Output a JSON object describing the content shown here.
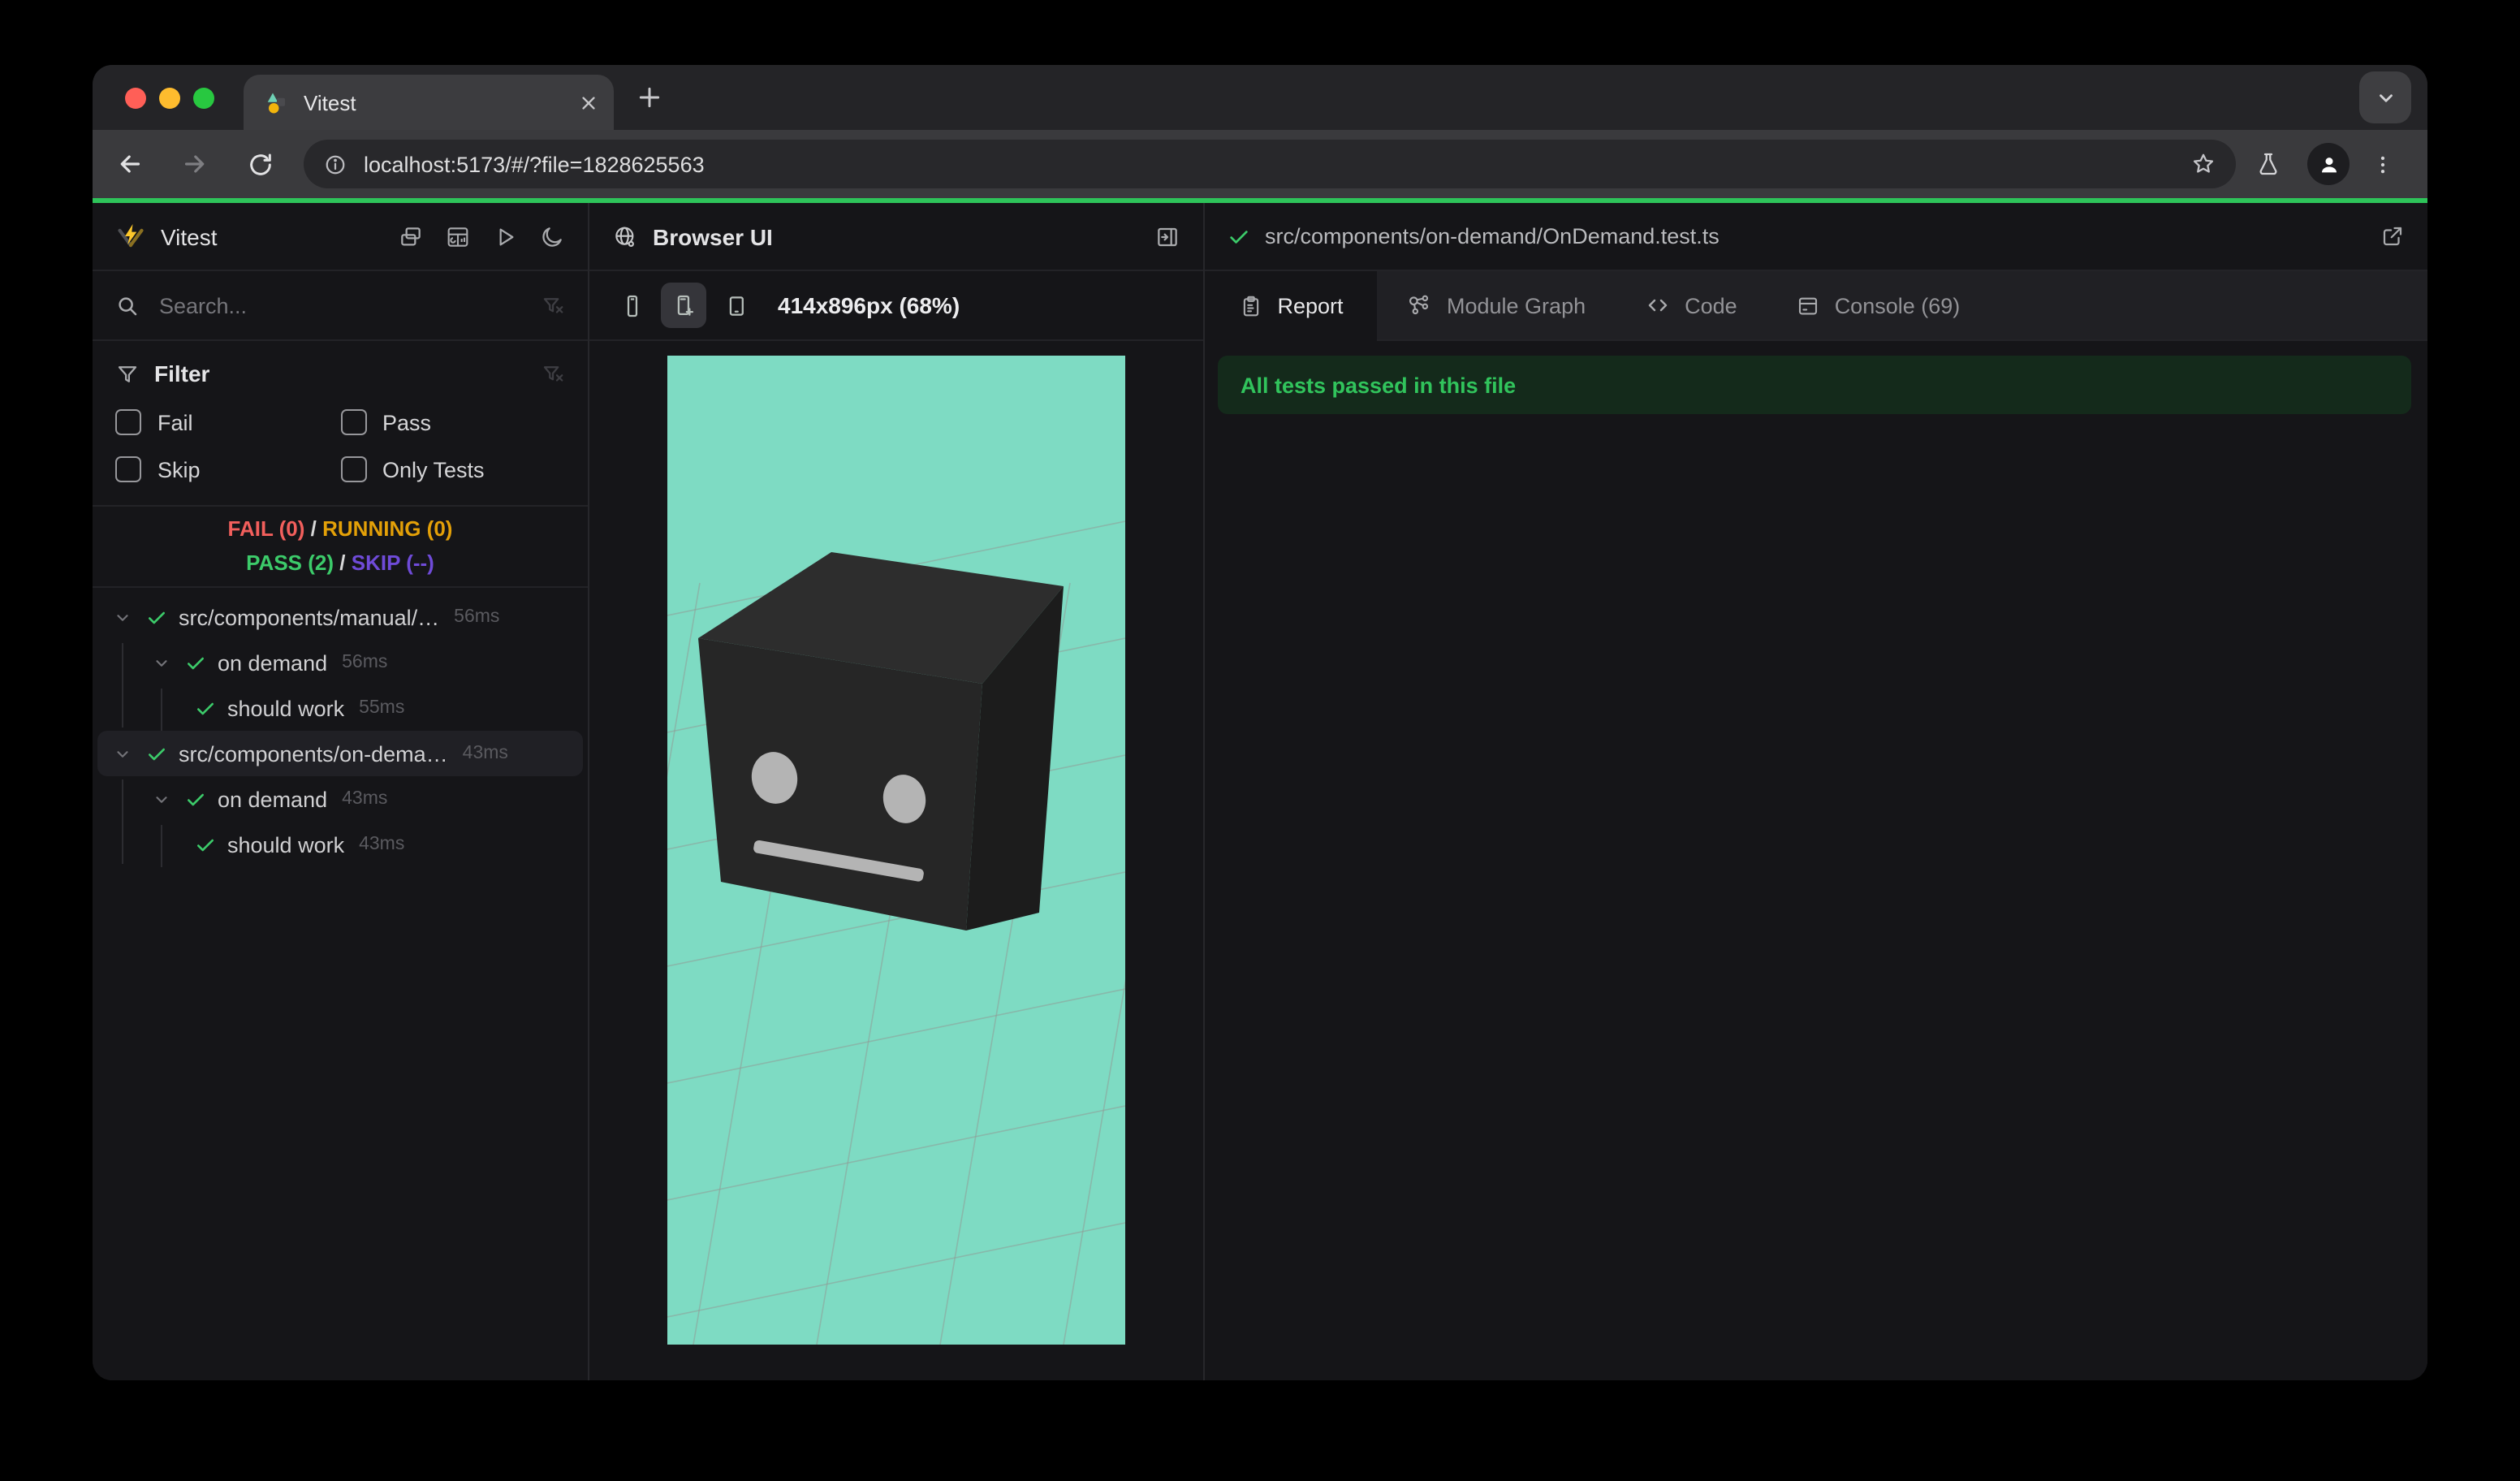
{
  "colors": {
    "accent_green": "#2ec45a",
    "pass_green": "#3ccb6a",
    "fail_red": "#f25f5c",
    "running_yellow": "#e3a008",
    "skip_purple": "#6f4bd8",
    "viewport_bg": "#7edbc3",
    "banner_bg": "#142a1b",
    "banner_text": "#31c45c",
    "grid_line": "#8f9b96",
    "cube_top": "#2d2d2d",
    "cube_left": "#262626",
    "cube_right": "#1c1c1c",
    "cube_face": "#b4b4b4"
  },
  "browser_chrome": {
    "tab_title": "Vitest",
    "url": "localhost:5173/#/?file=1828625563"
  },
  "sidebar": {
    "app_title": "Vitest",
    "search_placeholder": "Search...",
    "filter": {
      "title": "Filter",
      "options": [
        "Fail",
        "Pass",
        "Skip",
        "Only Tests"
      ]
    },
    "summary": {
      "fail": "FAIL (0)",
      "running": "RUNNING (0)",
      "pass": "PASS (2)",
      "skip": "SKIP (--)",
      "separator": "/"
    },
    "tree": {
      "rows": [
        {
          "name": "src/components/manual/…",
          "duration": "56ms"
        },
        {
          "name": "on demand",
          "duration": "56ms"
        },
        {
          "name": "should work",
          "duration": "55ms"
        },
        {
          "name": "src/components/on-dema…",
          "duration": "43ms"
        },
        {
          "name": "on demand",
          "duration": "43ms"
        },
        {
          "name": "should work",
          "duration": "43ms"
        }
      ]
    }
  },
  "browser_panel": {
    "title": "Browser UI",
    "viewport_label": "414x896px (68%)"
  },
  "report_panel": {
    "file_path": "src/components/on-demand/OnDemand.test.ts",
    "tabs": [
      {
        "label": "Report"
      },
      {
        "label": "Module Graph"
      },
      {
        "label": "Code"
      },
      {
        "label": "Console (69)"
      }
    ],
    "banner": "All tests passed in this file"
  }
}
